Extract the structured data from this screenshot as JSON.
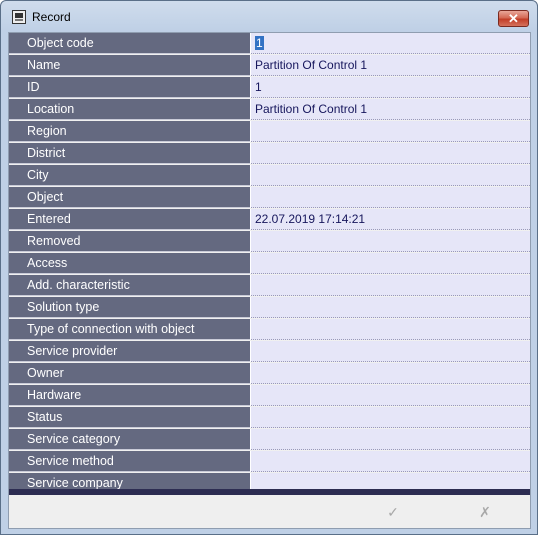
{
  "window": {
    "title": "Record",
    "close_glyph": "✕"
  },
  "fields": [
    {
      "label": "Object code",
      "value": "1",
      "selected": true
    },
    {
      "label": "Name",
      "value": "Partition  Of Control 1"
    },
    {
      "label": "ID",
      "value": "1"
    },
    {
      "label": "Location",
      "value": "Partition  Of Control 1"
    },
    {
      "label": "Region",
      "value": ""
    },
    {
      "label": "District",
      "value": ""
    },
    {
      "label": "City",
      "value": ""
    },
    {
      "label": "Object",
      "value": ""
    },
    {
      "label": "Entered",
      "value": "22.07.2019 17:14:21"
    },
    {
      "label": "Removed",
      "value": ""
    },
    {
      "label": "Access",
      "value": ""
    },
    {
      "label": "Add. characteristic",
      "value": ""
    },
    {
      "label": "Solution type",
      "value": ""
    },
    {
      "label": "Type of connection with object",
      "value": ""
    },
    {
      "label": "Service provider",
      "value": ""
    },
    {
      "label": "Owner",
      "value": ""
    },
    {
      "label": "Hardware",
      "value": ""
    },
    {
      "label": "Status",
      "value": ""
    },
    {
      "label": "Service category",
      "value": ""
    },
    {
      "label": "Service method",
      "value": ""
    },
    {
      "label": "Service company",
      "value": ""
    }
  ],
  "buttons": {
    "ok_icon": "check-icon",
    "cancel_icon": "cross-icon",
    "ok_glyph": "✓",
    "cancel_glyph": "✗"
  },
  "colors": {
    "label_bg": "#646980",
    "value_bg": "#e6e6f8",
    "selection": "#3372c4",
    "footer_bar": "#2d2d52"
  }
}
